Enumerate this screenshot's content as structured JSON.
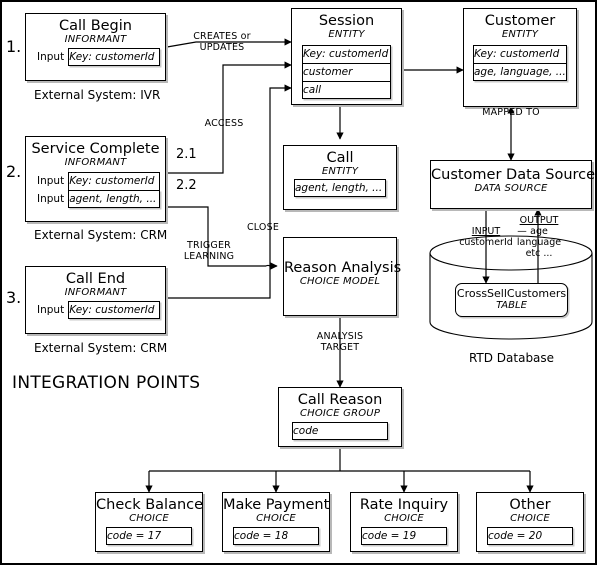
{
  "diagram": {
    "section_label": "INTEGRATION POINTS",
    "steps": [
      {
        "number": "1."
      },
      {
        "number": "2."
      },
      {
        "number": "3."
      }
    ],
    "sub_steps": [
      {
        "label": "2.1"
      },
      {
        "label": "2.2"
      }
    ],
    "nodes": {
      "call_begin": {
        "title": "Call Begin",
        "stereotype": "INFORMANT",
        "input_label": "Input",
        "attribute": "Key: customerId",
        "caption": "External System: IVR"
      },
      "service_complete": {
        "title": "Service Complete",
        "stereotype": "INFORMANT",
        "input_label_1": "Input",
        "input_label_2": "Input",
        "attribute_1": "Key: customerId",
        "attribute_2": "agent, length, ...",
        "caption": "External System: CRM"
      },
      "call_end": {
        "title": "Call End",
        "stereotype": "INFORMANT",
        "input_label": "Input",
        "attribute": "Key: customerId",
        "caption": "External System: CRM"
      },
      "session": {
        "title": "Session",
        "stereotype": "ENTITY",
        "attributes": [
          "Key: customerId",
          "customer",
          "call"
        ]
      },
      "call": {
        "title": "Call",
        "stereotype": "ENTITY",
        "attributes": [
          "agent, length, ..."
        ]
      },
      "customer": {
        "title": "Customer",
        "stereotype": "ENTITY",
        "attributes": [
          "Key: customerId",
          "age, language, ..."
        ]
      },
      "customer_data_source": {
        "title": "Customer Data Source",
        "stereotype": "DATA SOURCE"
      },
      "reason_analysis": {
        "title": "Reason Analysis",
        "stereotype": "CHOICE MODEL"
      },
      "call_reason": {
        "title": "Call Reason",
        "stereotype": "CHOICE GROUP",
        "attribute": "code"
      },
      "choices": [
        {
          "title": "Check Balance",
          "stereotype": "CHOICE",
          "attribute": "code = 17"
        },
        {
          "title": "Make Payment",
          "stereotype": "CHOICE",
          "attribute": "code = 18"
        },
        {
          "title": "Rate Inquiry",
          "stereotype": "CHOICE",
          "attribute": "code = 19"
        },
        {
          "title": "Other",
          "stereotype": "CHOICE",
          "attribute": "code = 20"
        }
      ],
      "database": {
        "label": "RTD Database",
        "table_name": "CrossSellCustomers",
        "table_stereotype": "TABLE",
        "input_header": "INPUT",
        "input_fields": "customerId",
        "output_header": "OUTPUT",
        "output_fields": "age\nlanguage\netc ...",
        "separator": "—"
      }
    },
    "edge_labels": {
      "creates_or_updates": "CREATES or\nUPDATES",
      "access": "ACCESS",
      "close": "CLOSE",
      "trigger_learning": "TRIGGER\nLEARNING",
      "mapped_to": "MAPPED TO",
      "analysis_target": "ANALYSIS\nTARGET"
    },
    "colors": {
      "line": "#000000",
      "shadow": "#b8b8b8",
      "background": "#ffffff"
    }
  }
}
